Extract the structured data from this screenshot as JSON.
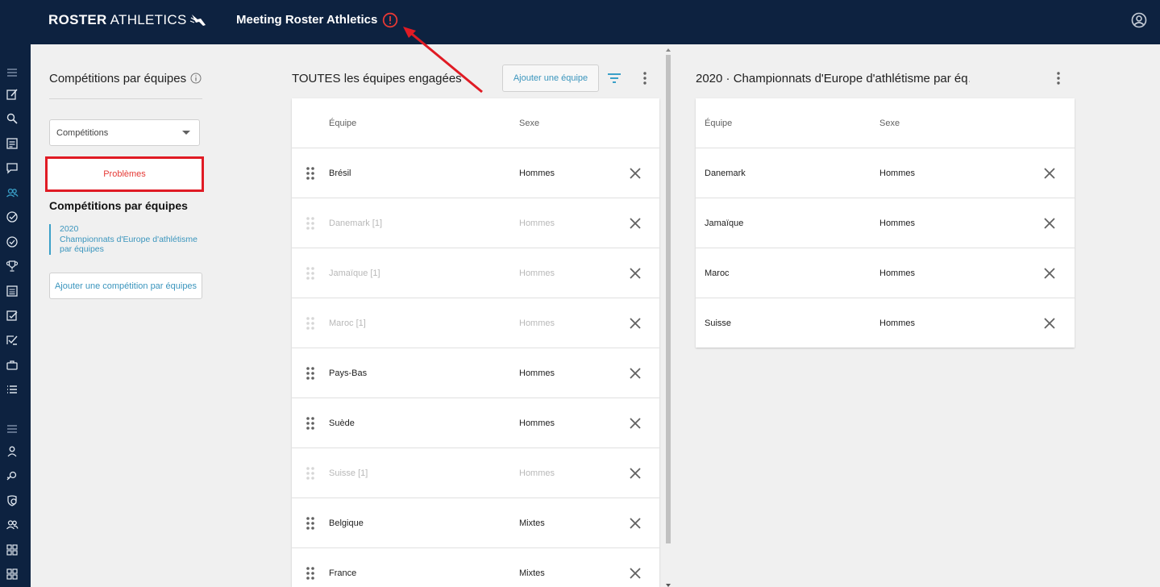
{
  "colors": {
    "topbar": "#0d2240",
    "alert": "#e53935",
    "accent": "#3a95bd",
    "highlight_border": "#e01b24"
  },
  "header": {
    "logo_bold": "ROSTER",
    "logo_light": "ATHLETICS",
    "app_title": "Meeting Roster Athletics",
    "alert_icon": "alert-circle-icon",
    "account_icon": "account-circle-icon"
  },
  "rail": {
    "icons": [
      "menu-icon",
      "edit-icon",
      "search-icon",
      "list-icon",
      "chat-icon",
      "team-icon",
      "check-circle-icon",
      "check-circle-outline-icon",
      "trophy-icon",
      "document-icon",
      "checkbox-icon",
      "checklist-icon",
      "briefcase-icon",
      "list-bullets-icon",
      "menu-icon",
      "person-icon",
      "whistle-icon",
      "shield-icon",
      "group-icon",
      "grid-icon",
      "grid-alt-icon"
    ]
  },
  "left_panel": {
    "title": "Compétitions par équipes",
    "select_value": "Compétitions",
    "problems_label": "Problèmes",
    "subtitle": "Compétitions par équipes",
    "competition": {
      "year": "2020",
      "name": "Championnats d'Europe d'athlétisme par équipes"
    },
    "add_competition_label": "Ajouter une compétition par équipes"
  },
  "middle_panel": {
    "title": "TOUTES les équipes engagées",
    "add_team_label": "Ajouter une équipe",
    "columns": [
      "Équipe",
      "Sexe"
    ],
    "rows": [
      {
        "team": "Brésil",
        "sex": "Hommes",
        "dimmed": false
      },
      {
        "team": "Danemark [1]",
        "sex": "Hommes",
        "dimmed": true
      },
      {
        "team": "Jamaïque [1]",
        "sex": "Hommes",
        "dimmed": true
      },
      {
        "team": "Maroc [1]",
        "sex": "Hommes",
        "dimmed": true
      },
      {
        "team": "Pays-Bas",
        "sex": "Hommes",
        "dimmed": false
      },
      {
        "team": "Suède",
        "sex": "Hommes",
        "dimmed": false
      },
      {
        "team": "Suisse [1]",
        "sex": "Hommes",
        "dimmed": true
      },
      {
        "team": "Belgique",
        "sex": "Mixtes",
        "dimmed": false
      },
      {
        "team": "France",
        "sex": "Mixtes",
        "dimmed": false
      }
    ]
  },
  "right_panel": {
    "title": "2020 · Championnats d'Europe d'athlétisme par éq…",
    "columns": [
      "Équipe",
      "Sexe"
    ],
    "rows": [
      {
        "team": "Danemark",
        "sex": "Hommes"
      },
      {
        "team": "Jamaïque",
        "sex": "Hommes"
      },
      {
        "team": "Maroc",
        "sex": "Hommes"
      },
      {
        "team": "Suisse",
        "sex": "Hommes"
      }
    ]
  }
}
